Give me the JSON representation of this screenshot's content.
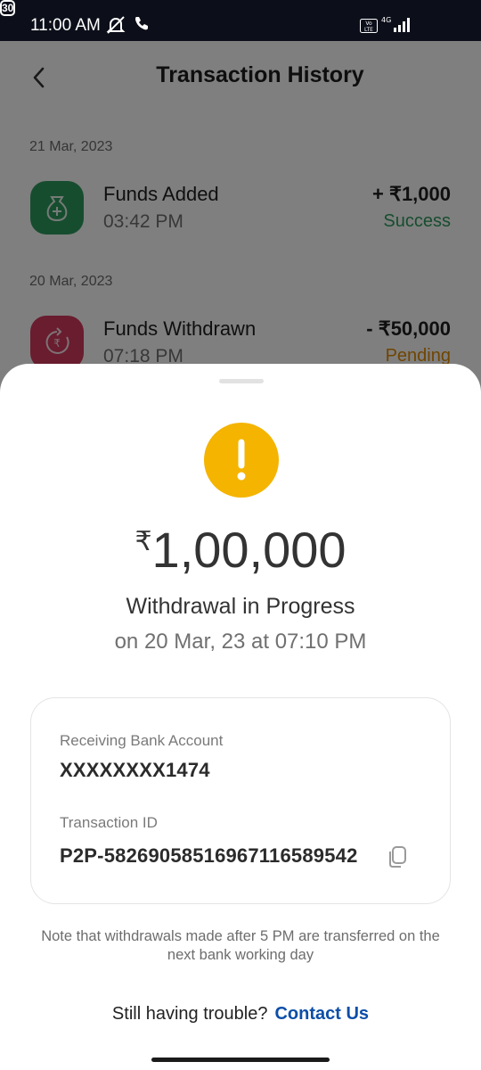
{
  "status_bar": {
    "time": "11:00 AM",
    "network": "4G",
    "volte": "Vo LTE",
    "battery": "30",
    "icons": [
      "mute-bell-icon",
      "phone-icon",
      "signal-icon",
      "battery-icon"
    ]
  },
  "header": {
    "title": "Transaction History",
    "back_icon": "chevron-left-icon"
  },
  "transactions": [
    {
      "date": "21 Mar, 2023",
      "name": "Funds Added",
      "time": "03:42 PM",
      "amount": "+ ₹1,000",
      "status": "Success",
      "icon": "money-bag-plus-icon",
      "icon_color": "#2e9a5e",
      "status_color": "#2e9a5e"
    },
    {
      "date": "20 Mar, 2023",
      "name": "Funds Withdrawn",
      "time": "07:18 PM",
      "amount": "- ₹50,000",
      "status": "Pending",
      "icon": "rupee-withdraw-icon",
      "icon_color": "#d23a5e",
      "status_color": "#e08a00"
    }
  ],
  "sheet": {
    "warning_icon": "exclamation-icon",
    "warning_color": "#f4b400",
    "currency_symbol": "₹",
    "amount": "1,00,000",
    "status_title": "Withdrawal in Progress",
    "status_date": "on 20 Mar, 23 at 07:10 PM",
    "details": {
      "bank_label": "Receiving Bank Account",
      "bank_value": "XXXXXXXX1474",
      "txn_label": "Transaction ID",
      "txn_value": "P2P-582690585169671165895 42",
      "copy_icon": "copy-icon"
    },
    "note": "Note that withdrawals made after 5 PM are transferred on the next bank working day",
    "help_text": "Still having trouble?",
    "help_link": "Contact Us",
    "link_color": "#0d4ea8"
  }
}
